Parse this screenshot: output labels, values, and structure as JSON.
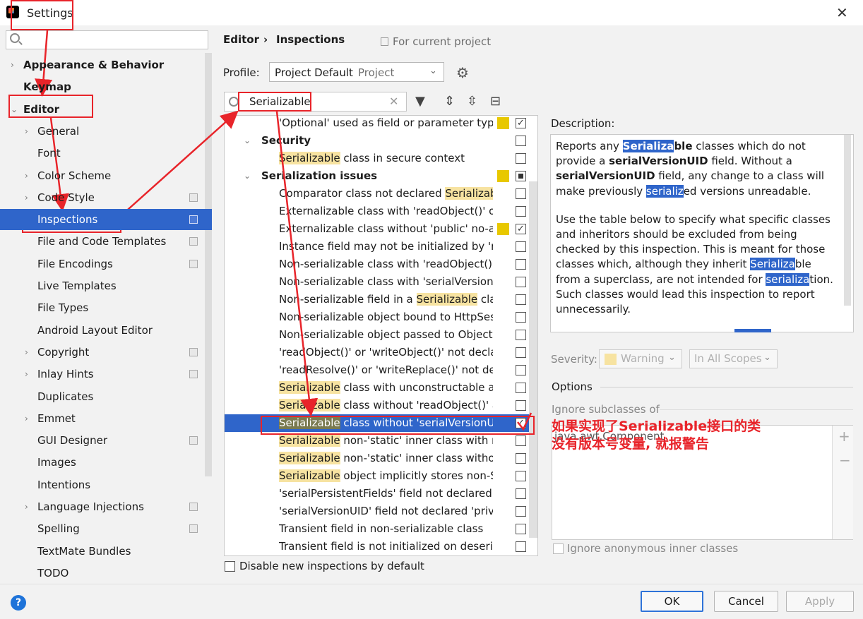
{
  "window": {
    "title": "Settings"
  },
  "sidebar": {
    "search_placeholder": "",
    "items": [
      {
        "label": "Appearance & Behavior",
        "arrow": "›",
        "bold": true
      },
      {
        "label": "Keymap",
        "bold": true
      },
      {
        "label": "Editor",
        "arrow": "⌄",
        "bold": true
      },
      {
        "label": "General",
        "arrow": "›"
      },
      {
        "label": "Font"
      },
      {
        "label": "Color Scheme",
        "arrow": "›"
      },
      {
        "label": "Code Style",
        "arrow": "›",
        "project": true
      },
      {
        "label": "Inspections",
        "project": true,
        "selected": true
      },
      {
        "label": "File and Code Templates",
        "project": true
      },
      {
        "label": "File Encodings",
        "project": true
      },
      {
        "label": "Live Templates"
      },
      {
        "label": "File Types"
      },
      {
        "label": "Android Layout Editor"
      },
      {
        "label": "Copyright",
        "arrow": "›",
        "project": true
      },
      {
        "label": "Inlay Hints",
        "arrow": "›",
        "project": true
      },
      {
        "label": "Duplicates"
      },
      {
        "label": "Emmet",
        "arrow": "›"
      },
      {
        "label": "GUI Designer",
        "project": true
      },
      {
        "label": "Images"
      },
      {
        "label": "Intentions"
      },
      {
        "label": "Language Injections",
        "arrow": "›",
        "project": true
      },
      {
        "label": "Spelling",
        "project": true
      },
      {
        "label": "TextMate Bundles"
      },
      {
        "label": "TODO"
      }
    ]
  },
  "breadcrumb": {
    "parent": "Editor",
    "separator": "›",
    "current": "Inspections",
    "scope": "For current project"
  },
  "profile": {
    "label": "Profile:",
    "value": "Project Default",
    "scope": "Project"
  },
  "filter": {
    "value": "Serializable"
  },
  "inspections": [
    {
      "pre": "",
      "hl": "",
      "post": "'Optional' used as field or parameter type",
      "indent": 2,
      "sev": true,
      "check": "checked"
    },
    {
      "pre": "Security",
      "hl": "",
      "post": "",
      "indent": 1,
      "cat": true,
      "check": "none"
    },
    {
      "pre": "",
      "hl": "Serializable",
      "post": " class in secure context",
      "indent": 2,
      "check": "none"
    },
    {
      "pre": "Serialization issues",
      "hl": "",
      "post": "",
      "indent": 1,
      "cat": true,
      "sev": true,
      "check": "mixed"
    },
    {
      "pre": "Comparator class not declared ",
      "hl": "Serializable",
      "post": "",
      "indent": 2,
      "check": "none"
    },
    {
      "pre": "Externalizable class with 'readObject()' or",
      "hl": "",
      "post": "",
      "indent": 2,
      "check": "none"
    },
    {
      "pre": "Externalizable class without 'public' no-arg",
      "hl": "",
      "post": "",
      "indent": 2,
      "sev": true,
      "check": "checked"
    },
    {
      "pre": "Instance field may not be initialized by 'readObject()'",
      "hl": "",
      "post": "",
      "indent": 2,
      "check": "none"
    },
    {
      "pre": "Non-serializable class with 'readObject()' or",
      "hl": "",
      "post": "",
      "indent": 2,
      "check": "none"
    },
    {
      "pre": "Non-serializable class with 'serialVersionUID'",
      "hl": "",
      "post": "",
      "indent": 2,
      "check": "none"
    },
    {
      "pre": "Non-serializable field in a ",
      "hl": "Serializable",
      "post": " class",
      "indent": 2,
      "check": "none"
    },
    {
      "pre": "Non-serializable object bound to HttpSession",
      "hl": "",
      "post": "",
      "indent": 2,
      "check": "none"
    },
    {
      "pre": "Non-serializable object passed to ObjectOutputStream",
      "hl": "",
      "post": "",
      "indent": 2,
      "check": "none"
    },
    {
      "pre": "'readObject()' or 'writeObject()' not declared",
      "hl": "",
      "post": "",
      "indent": 2,
      "check": "none"
    },
    {
      "pre": "'readResolve()' or 'writeReplace()' not declared",
      "hl": "",
      "post": "",
      "indent": 2,
      "check": "none"
    },
    {
      "pre": "",
      "hl": "Serializable",
      "post": " class with unconstructable ancestor",
      "indent": 2,
      "check": "none"
    },
    {
      "pre": "",
      "hl": "Serializable",
      "post": " class without 'readObject()' and",
      "indent": 2,
      "check": "none"
    },
    {
      "pre": "",
      "hl": "Serializable",
      "post": " class without 'serialVersionUID'",
      "indent": 2,
      "selected": true,
      "check": "checked"
    },
    {
      "pre": "",
      "hl": "Serializable",
      "post": " non-'static' inner class with non",
      "indent": 2,
      "check": "none"
    },
    {
      "pre": "",
      "hl": "Serializable",
      "post": " non-'static' inner class without",
      "indent": 2,
      "check": "none"
    },
    {
      "pre": "",
      "hl": "Serializable",
      "post": " object implicitly stores non-Serializable",
      "indent": 2,
      "check": "none"
    },
    {
      "pre": "'serialPersistentFields' field not declared 'private static final'",
      "hl": "",
      "post": "",
      "indent": 2,
      "check": "none"
    },
    {
      "pre": "'serialVersionUID' field not declared 'private static final'",
      "hl": "",
      "post": "",
      "indent": 2,
      "check": "none"
    },
    {
      "pre": "Transient field in non-serializable class",
      "hl": "",
      "post": "",
      "indent": 2,
      "check": "none"
    },
    {
      "pre": "Transient field is not initialized on deserialization",
      "hl": "",
      "post": "",
      "indent": 2,
      "check": "none"
    }
  ],
  "disable_new": {
    "label": "Disable new inspections by default"
  },
  "description": {
    "label": "Description:",
    "p1": [
      {
        "t": "Reports any "
      },
      {
        "t": "Serializa",
        "b": true,
        "s": true
      },
      {
        "t": "ble",
        "b": true
      },
      {
        "t": " classes which do not provide a "
      },
      {
        "t": "serialVersionUID",
        "b": true
      },
      {
        "t": " field. Without a "
      },
      {
        "t": "serialVersionUID",
        "b": true
      },
      {
        "t": " field, any change to a class will make previously "
      },
      {
        "t": "serializ",
        "s": true
      },
      {
        "t": "ed versions unreadable."
      }
    ],
    "p2": [
      {
        "t": "Use the table below to specify what specific classes and inheritors should be excluded from being checked by this inspection. This is meant for those classes which, although they inherit "
      },
      {
        "t": "Serializa",
        "s": true
      },
      {
        "t": "ble from a superclass, are not intended for "
      },
      {
        "t": "serializa",
        "s": true
      },
      {
        "t": "tion. Such classes would lead this inspection to report unnecessarily."
      }
    ]
  },
  "severity": {
    "label": "Severity:",
    "value": "Warning",
    "scope": "In All Scopes"
  },
  "options": {
    "label": "Options",
    "ignore_label": "Ignore subclasses of",
    "ignore_item": "java.awt.Component",
    "anon_label": "Ignore anonymous inner classes"
  },
  "buttons": {
    "ok": "OK",
    "cancel": "Cancel",
    "apply": "Apply"
  },
  "help": "?",
  "annotation": {
    "line1": "如果实现了Serializable接口的类",
    "line2": "没有版本号变量, 就报警告",
    "color": "#e8242a"
  }
}
